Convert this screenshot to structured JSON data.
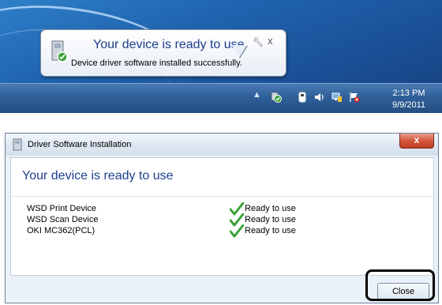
{
  "notification": {
    "title": "Your device is ready to use",
    "message": "Device driver software installed successfully.",
    "pin_icon": "wrench-icon",
    "close_label": "x"
  },
  "taskbar": {
    "time": "2:13 PM",
    "date": "9/9/2011",
    "tray_icons": [
      "show-hidden-icons-arrow",
      "driver-install-icon",
      "usb-device-icon",
      "volume-icon",
      "network-icon",
      "action-center-icon"
    ]
  },
  "dialog": {
    "title": "Driver Software Installation",
    "heading": "Your device is ready to use",
    "title_close_label": "x",
    "devices": [
      {
        "name": "WSD Print Device",
        "status": "Ready to use"
      },
      {
        "name": "WSD Scan Device",
        "status": "Ready to use"
      },
      {
        "name": "OKI MC362(PCL)",
        "status": "Ready to use"
      }
    ],
    "close_button": "Close"
  },
  "colors": {
    "heading_blue": "#1e3f8f",
    "taskbar": "#2f5f98",
    "title_close_red": "#d4563a",
    "check_green": "#3aa33a"
  }
}
